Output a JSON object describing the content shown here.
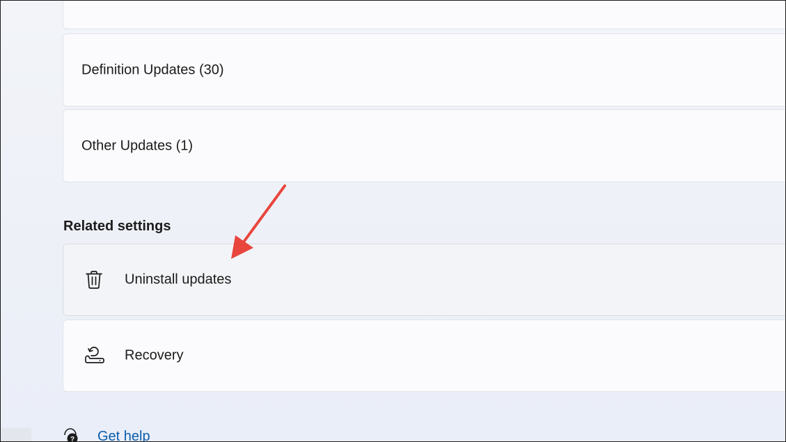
{
  "update_categories": [
    {
      "label": "Definition Updates (30)"
    },
    {
      "label": "Other Updates (1)"
    }
  ],
  "related_settings": {
    "title": "Related settings",
    "items": [
      {
        "label": "Uninstall updates",
        "icon": "trash-icon"
      },
      {
        "label": "Recovery",
        "icon": "recovery-icon"
      }
    ]
  },
  "help": {
    "label": "Get help",
    "icon": "help-icon"
  },
  "colors": {
    "annotation_arrow": "#e8453c",
    "link": "#0b5cad"
  }
}
